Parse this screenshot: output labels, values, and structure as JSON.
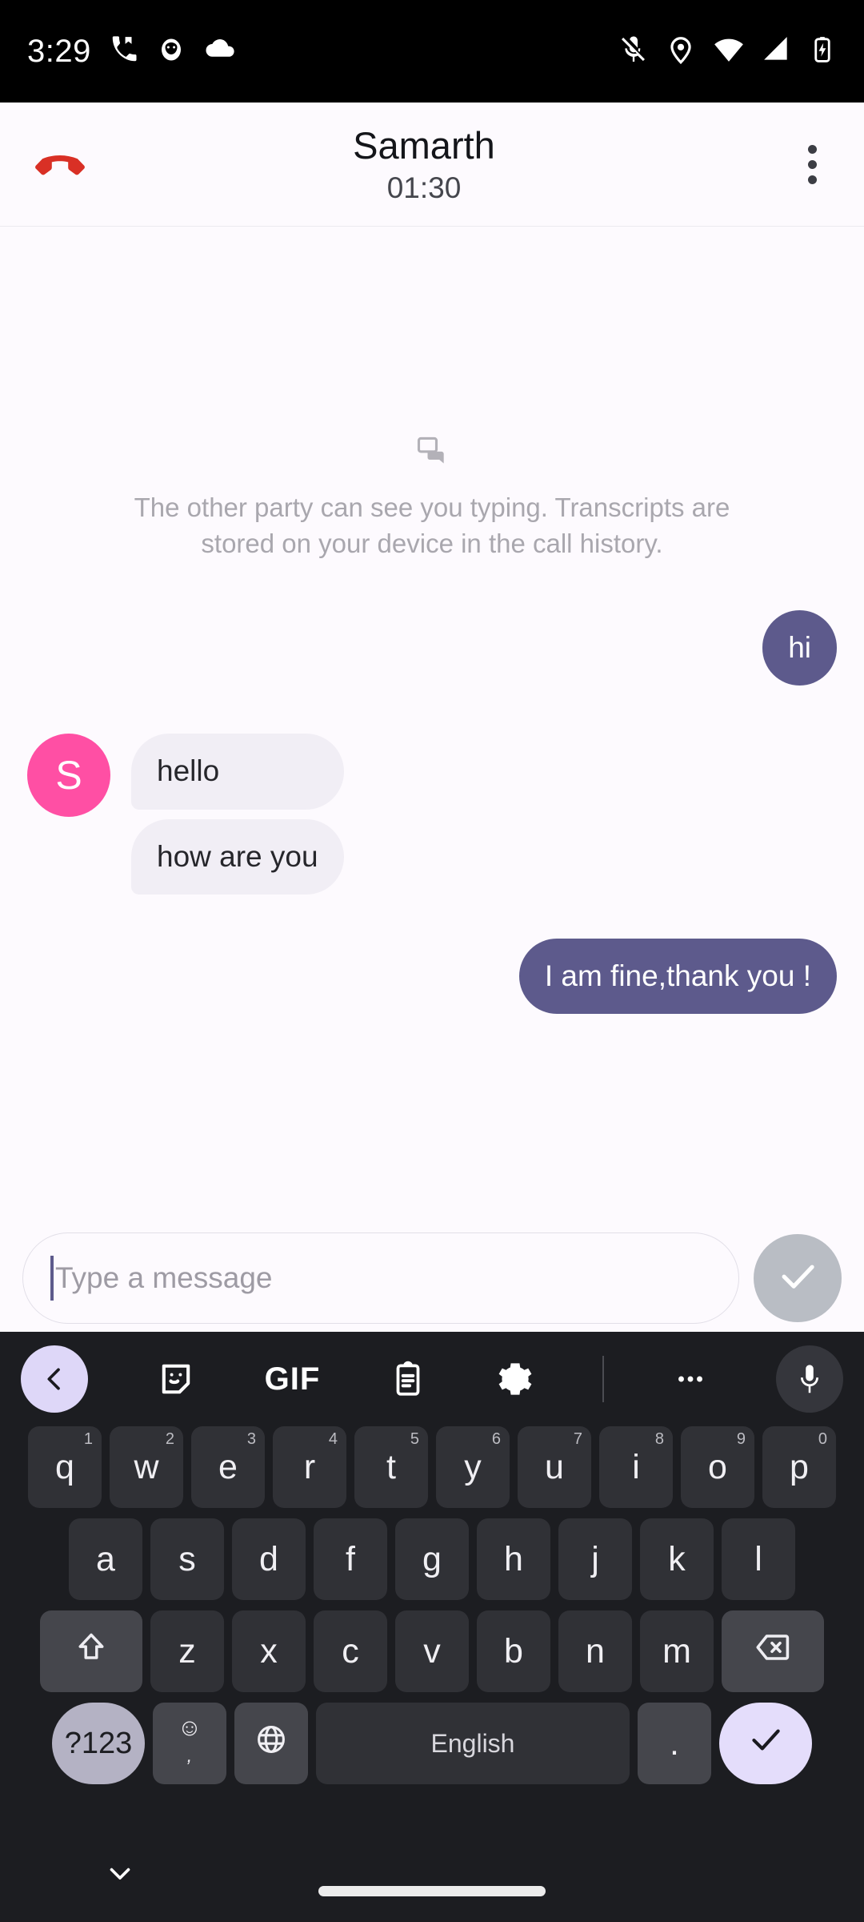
{
  "statusbar": {
    "time": "3:29",
    "left_icons": [
      "missed-call-icon",
      "app-notification-icon",
      "cloud-icon"
    ],
    "right_icons": [
      "mic-off-icon",
      "location-icon",
      "wifi-icon",
      "cellular-signal-icon",
      "battery-charging-icon"
    ]
  },
  "call_header": {
    "hangup_label": "end-call",
    "contact_name": "Samarth",
    "call_duration": "01:30",
    "overflow_label": "more-options"
  },
  "chat": {
    "notice_icon": "chat-bubbles-icon",
    "notice_text": "The other party can see you typing. Transcripts are stored on your device in the call history.",
    "avatar_initial": "S",
    "messages": [
      {
        "side": "out",
        "text": "hi"
      },
      {
        "side": "in",
        "text": "hello"
      },
      {
        "side": "in",
        "text": "how are you"
      },
      {
        "side": "out",
        "text": "I am fine,thank you !"
      }
    ]
  },
  "composer": {
    "placeholder": "Type a message",
    "value": "",
    "send_label": "send"
  },
  "keyboard": {
    "toolbar": [
      {
        "name": "back-chevron-icon",
        "label": ""
      },
      {
        "name": "sticker-icon",
        "label": ""
      },
      {
        "name": "gif-icon",
        "label": "GIF"
      },
      {
        "name": "clipboard-icon",
        "label": ""
      },
      {
        "name": "settings-gear-icon",
        "label": ""
      },
      {
        "name": "overflow-dots-icon",
        "label": ""
      },
      {
        "name": "microphone-icon",
        "label": ""
      }
    ],
    "row1": [
      {
        "key": "q",
        "num": "1"
      },
      {
        "key": "w",
        "num": "2"
      },
      {
        "key": "e",
        "num": "3"
      },
      {
        "key": "r",
        "num": "4"
      },
      {
        "key": "t",
        "num": "5"
      },
      {
        "key": "y",
        "num": "6"
      },
      {
        "key": "u",
        "num": "7"
      },
      {
        "key": "i",
        "num": "8"
      },
      {
        "key": "o",
        "num": "9"
      },
      {
        "key": "p",
        "num": "0"
      }
    ],
    "row2": [
      "a",
      "s",
      "d",
      "f",
      "g",
      "h",
      "j",
      "k",
      "l"
    ],
    "row3": [
      "z",
      "x",
      "c",
      "v",
      "b",
      "n",
      "m"
    ],
    "shift_label": "shift",
    "backspace_label": "backspace",
    "symbols_label": "?123",
    "emoji_label": "☺",
    "emoji_sub_label": ",",
    "language_label": "globe",
    "space_label": "English",
    "period_label": ".",
    "enter_label": "enter"
  },
  "navbar": {
    "hide_keyboard_label": "hide-keyboard",
    "home_pill_label": "home"
  },
  "colors": {
    "accent_purple": "#5d5a8c",
    "avatar_pink": "#ff4fa4",
    "hangup_red": "#d93025",
    "chat_background": "#fdfafe",
    "incoming_bubble": "#f1eef5",
    "keyboard_background": "#1c1d21",
    "key_background": "#303136",
    "enter_key": "#e4ddfb",
    "send_button": "#b9bdc4"
  }
}
